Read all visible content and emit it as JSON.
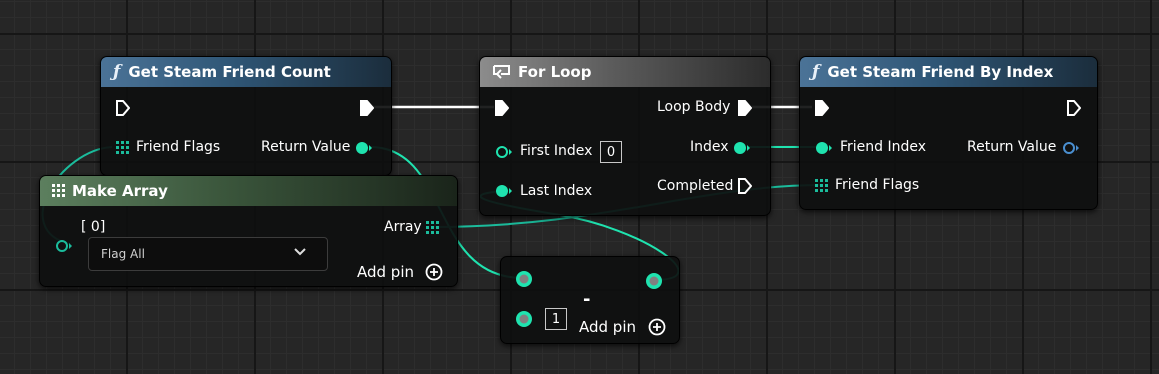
{
  "colors": {
    "grid_bg": "#262626",
    "exec_wire": "#ffffff",
    "int_pin": "#1fe3af",
    "struct_pin": "#1bbc9c",
    "func_header": "#2f5676",
    "macro_header": "#5c5c5c",
    "array_header": "#3a553b"
  },
  "nodes": {
    "get_friend_count": {
      "title": "Get Steam Friend Count",
      "icon": "function-f-icon",
      "inputs": {
        "friend_flags": "Friend Flags"
      },
      "outputs": {
        "return_value": "Return Value"
      }
    },
    "make_array": {
      "title": "Make Array",
      "icon": "array-grid-icon",
      "element_label": "[ 0]",
      "element_value": "Flag All",
      "output": "Array",
      "add_pin": "Add pin"
    },
    "for_loop": {
      "title": "For Loop",
      "icon": "loop-icon",
      "inputs": {
        "first_index": "First Index",
        "first_index_value": "0",
        "last_index": "Last Index"
      },
      "outputs": {
        "loop_body": "Loop Body",
        "index": "Index",
        "completed": "Completed"
      }
    },
    "get_friend_by_index": {
      "title": "Get Steam Friend By Index",
      "icon": "function-f-icon",
      "inputs": {
        "friend_index": "Friend Index",
        "friend_flags": "Friend Flags"
      },
      "outputs": {
        "return_value": "Return Value"
      }
    },
    "subtract": {
      "operator": "-",
      "b_value": "1",
      "add_pin": "Add pin"
    }
  }
}
